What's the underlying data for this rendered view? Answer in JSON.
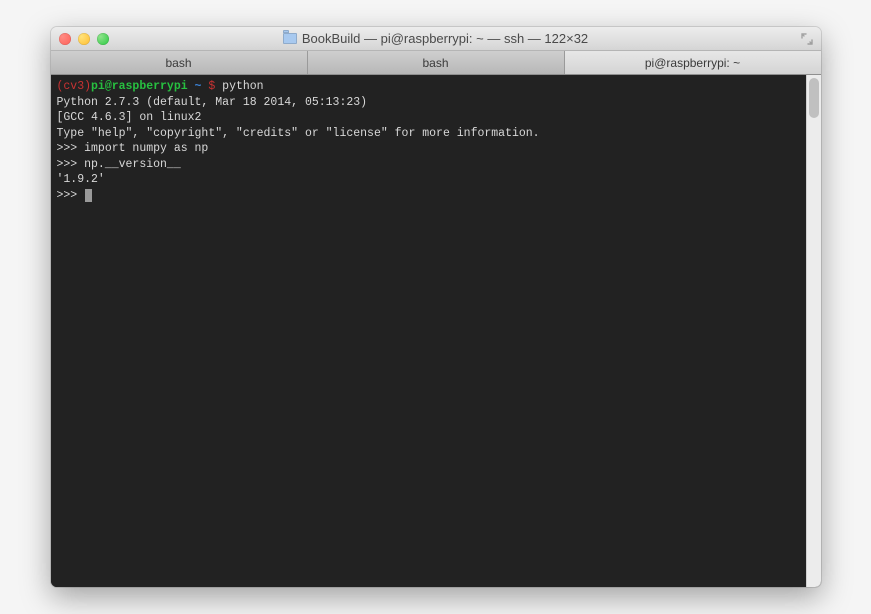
{
  "window": {
    "title": "BookBuild — pi@raspberrypi: ~ — ssh — 122×32"
  },
  "tabs": [
    {
      "label": "bash",
      "active": false
    },
    {
      "label": "bash",
      "active": false
    },
    {
      "label": "pi@raspberrypi: ~",
      "active": true
    }
  ],
  "terminal": {
    "prompt": {
      "venv": "(cv3)",
      "userhost": "pi@raspberrypi",
      "tilde": " ~ ",
      "dollar": "$ ",
      "command": "python"
    },
    "lines": [
      "Python 2.7.3 (default, Mar 18 2014, 05:13:23)",
      "[GCC 4.6.3] on linux2",
      "Type \"help\", \"copyright\", \"credits\" or \"license\" for more information."
    ],
    "repl": [
      {
        "prompt": ">>> ",
        "input": "import numpy as np",
        "output": null
      },
      {
        "prompt": ">>> ",
        "input": "np.__version__",
        "output": "'1.9.2'"
      }
    ],
    "final_prompt": ">>> "
  }
}
